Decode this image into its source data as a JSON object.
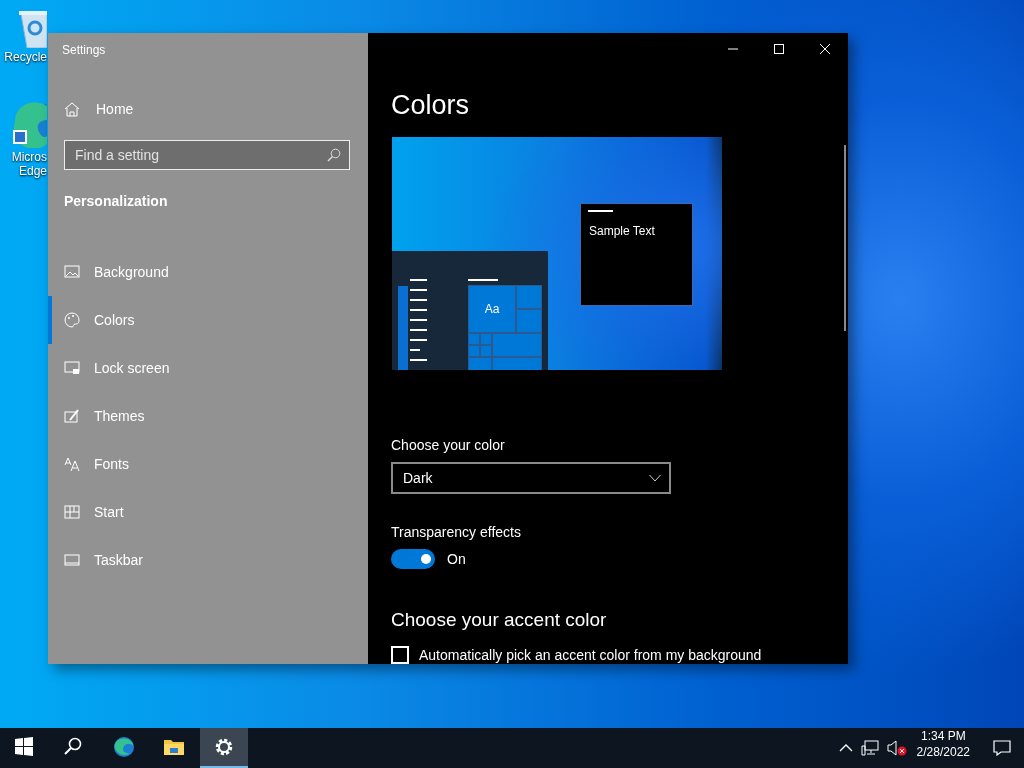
{
  "desktop_icons": [
    {
      "kind": "recycle",
      "lines": [
        "Recycle"
      ]
    },
    {
      "kind": "edge",
      "lines": [
        "Micros",
        "Edge"
      ]
    }
  ],
  "window": {
    "title": "Settings"
  },
  "sidebar": {
    "home": "Home",
    "search": {
      "placeholder": "Find a setting"
    },
    "section": "Personalization",
    "items": [
      {
        "kind": "background",
        "label": "Background",
        "selected": false
      },
      {
        "kind": "colors",
        "label": "Colors",
        "selected": true
      },
      {
        "kind": "lock",
        "label": "Lock screen",
        "selected": false
      },
      {
        "kind": "themes",
        "label": "Themes",
        "selected": false
      },
      {
        "kind": "fonts",
        "label": "Fonts",
        "selected": false
      },
      {
        "kind": "start",
        "label": "Start",
        "selected": false
      },
      {
        "kind": "taskbar",
        "label": "Taskbar",
        "selected": false
      }
    ]
  },
  "content": {
    "title": "Colors",
    "preview": {
      "sample_text": "Sample Text",
      "tile_text": "Aa"
    },
    "choose_color": {
      "label": "Choose your color",
      "value": "Dark"
    },
    "transparency": {
      "label": "Transparency effects",
      "on": true,
      "state_text": "On"
    },
    "accent_heading": "Choose your accent color",
    "auto_accent": {
      "label": "Automatically pick an accent color from my background",
      "checked": false
    }
  },
  "taskbar": {
    "apps": [
      {
        "kind": "start",
        "active": false
      },
      {
        "kind": "search",
        "active": false
      },
      {
        "kind": "edge",
        "active": false
      },
      {
        "kind": "explorer",
        "active": false
      },
      {
        "kind": "settings",
        "active": true
      }
    ],
    "time": "1:34 PM",
    "date": "2/28/2022"
  }
}
